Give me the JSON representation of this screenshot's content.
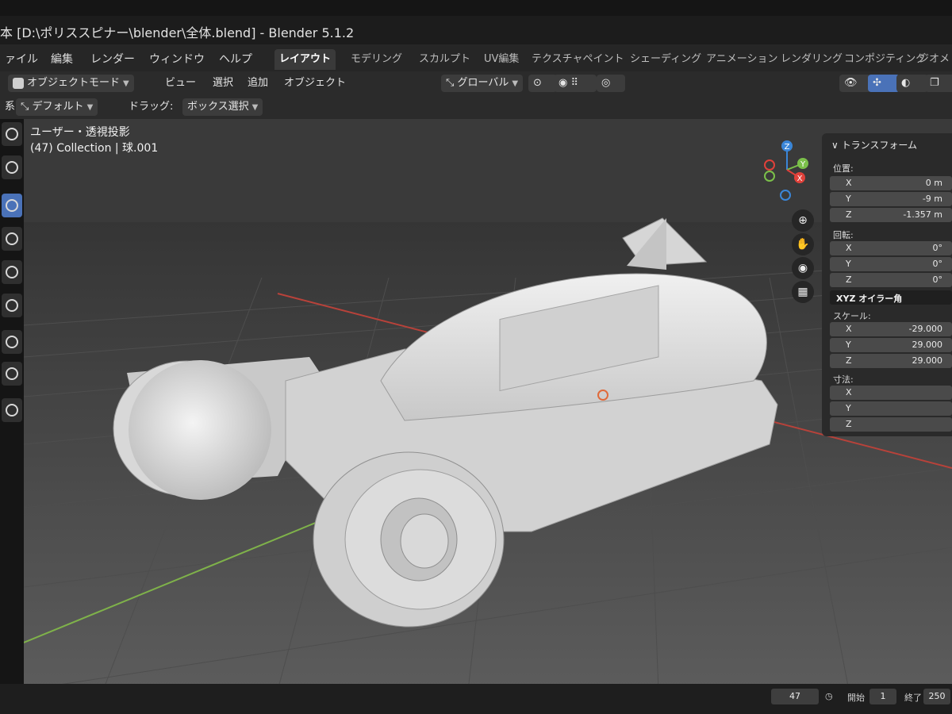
{
  "window": {
    "title": "本 [D:\\ポリススピナー\\blender\\全体.blend] - Blender 5.1.2"
  },
  "menu": {
    "items": [
      "ァイル",
      "編集",
      "レンダー",
      "ウィンドウ",
      "ヘルプ"
    ]
  },
  "workspaces": {
    "active": "レイアウト",
    "tabs": [
      "レイアウト",
      "モデリング",
      "スカルプト",
      "UV編集",
      "テクスチャペイント",
      "シェーディング",
      "アニメーション",
      "レンダリング",
      "コンポジティング",
      "ジオメト"
    ]
  },
  "header": {
    "mode": "オブジェクトモード",
    "menus": [
      "ビュー",
      "選択",
      "追加",
      "オブジェクト"
    ],
    "orientation": "グローバル"
  },
  "header2": {
    "orientation_label": "系:",
    "orientation_value": "デフォルト",
    "drag_label": "ドラッグ:",
    "drag_value": "ボックス選択"
  },
  "viewport": {
    "view_name": "ユーザー・透視投影",
    "context": "(47) Collection | 球.001"
  },
  "gizmo": {
    "axes": [
      "Z",
      "Y",
      "X"
    ],
    "colors": {
      "x": "#e0413a",
      "y": "#7bc04a",
      "z": "#3a86d8"
    }
  },
  "sidebar": {
    "title": "トランスフォーム",
    "location_label": "位置:",
    "location": [
      {
        "axis": "X",
        "value": "0 m"
      },
      {
        "axis": "Y",
        "value": "-9 m"
      },
      {
        "axis": "Z",
        "value": "-1.357 m"
      }
    ],
    "rotation_label": "回転:",
    "rotation": [
      {
        "axis": "X",
        "value": "0°"
      },
      {
        "axis": "Y",
        "value": "0°"
      },
      {
        "axis": "Z",
        "value": "0°"
      }
    ],
    "rotation_mode": "XYZ オイラー角",
    "scale_label": "スケール:",
    "scale": [
      {
        "axis": "X",
        "value": "-29.000"
      },
      {
        "axis": "Y",
        "value": "29.000"
      },
      {
        "axis": "Z",
        "value": "29.000"
      }
    ],
    "dimensions_label": "寸法:",
    "dimensions": [
      {
        "axis": "X",
        "value": ""
      },
      {
        "axis": "Y",
        "value": ""
      },
      {
        "axis": "Z",
        "value": ""
      }
    ]
  },
  "timeline": {
    "current_frame": "47",
    "start_label": "開始",
    "start": "1",
    "end_label": "終了",
    "end": "250"
  }
}
